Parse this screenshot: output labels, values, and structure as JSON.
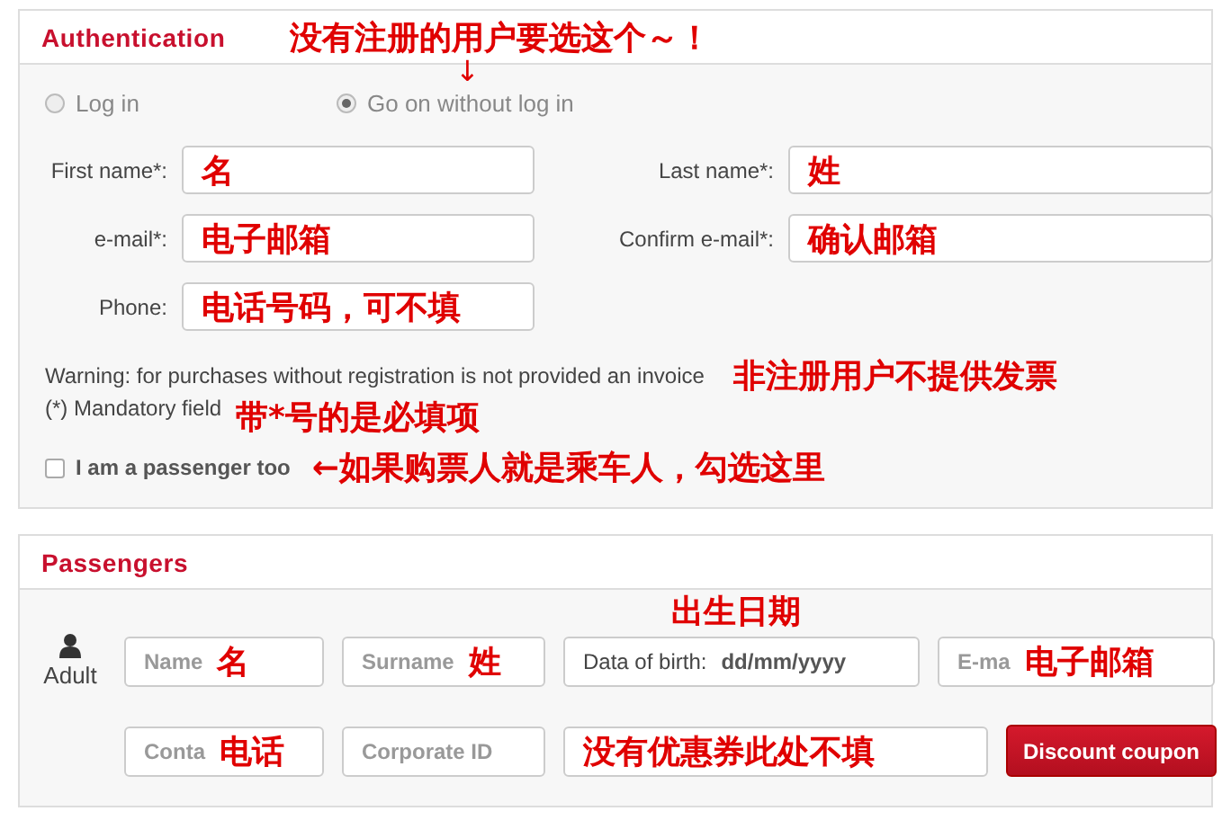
{
  "authentication": {
    "title": "Authentication",
    "note": "没有注册的用户要选这个～！",
    "arrow": "↓",
    "options": [
      {
        "label": "Log in",
        "selected": false
      },
      {
        "label": "Go on without log in",
        "selected": true
      }
    ],
    "fields": [
      {
        "label": "First name*:",
        "value": "名"
      },
      {
        "label": "Last name*:",
        "value": "姓"
      },
      {
        "label": "e-mail*:",
        "value": "电子邮箱"
      },
      {
        "label": "Confirm e-mail*:",
        "value": "确认邮箱"
      },
      {
        "label": "Phone:",
        "value": "电话号码，可不填"
      }
    ],
    "warning": "Warning: for purchases without registration is not provided an invoice",
    "warning_note": "非注册用户不提供发票",
    "mandatory": "(*) Mandatory field",
    "mandatory_note": "带*号的是必填项",
    "passenger_checkbox": {
      "label": "I am a passenger too",
      "checked": false,
      "note": "←如果购票人就是乘车人，勾选这里"
    }
  },
  "passengers": {
    "title": "Passengers",
    "passenger_type": "Adult",
    "fields": [
      {
        "kind": "text",
        "placeholder": "Name",
        "note": "名"
      },
      {
        "kind": "text",
        "placeholder": "Surname",
        "note": "姓"
      },
      {
        "kind": "date",
        "label": "Data of birth:",
        "value": "dd/mm/yyyy",
        "note": "出生日期"
      },
      {
        "kind": "text",
        "placeholder": "E-ma",
        "note": "电子邮箱"
      },
      {
        "kind": "text",
        "placeholder": "Conta",
        "note": "电话"
      },
      {
        "kind": "text",
        "placeholder": "Corporate ID"
      },
      {
        "kind": "wide",
        "note": "没有优惠券此处不填"
      }
    ],
    "button": "Discount coupon"
  }
}
